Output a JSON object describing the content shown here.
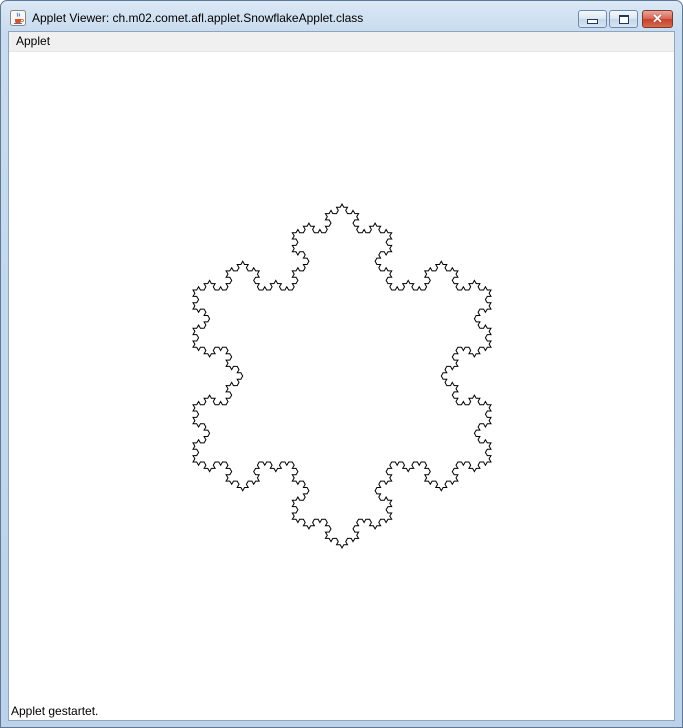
{
  "window": {
    "title": "Applet Viewer: ch.m02.comet.afl.applet.SnowflakeApplet.class",
    "app_icon": "java-cup-icon",
    "controls": {
      "minimize_icon": "minimize-icon",
      "maximize_icon": "maximize-icon",
      "close_icon": "close-icon",
      "close_glyph": "✕"
    }
  },
  "menubar": {
    "items": [
      {
        "label": "Applet"
      }
    ]
  },
  "applet": {
    "figure": "koch-snowflake",
    "stroke_color": "#000000",
    "background_color": "#ffffff"
  },
  "status": {
    "text": "Applet gestartet."
  }
}
